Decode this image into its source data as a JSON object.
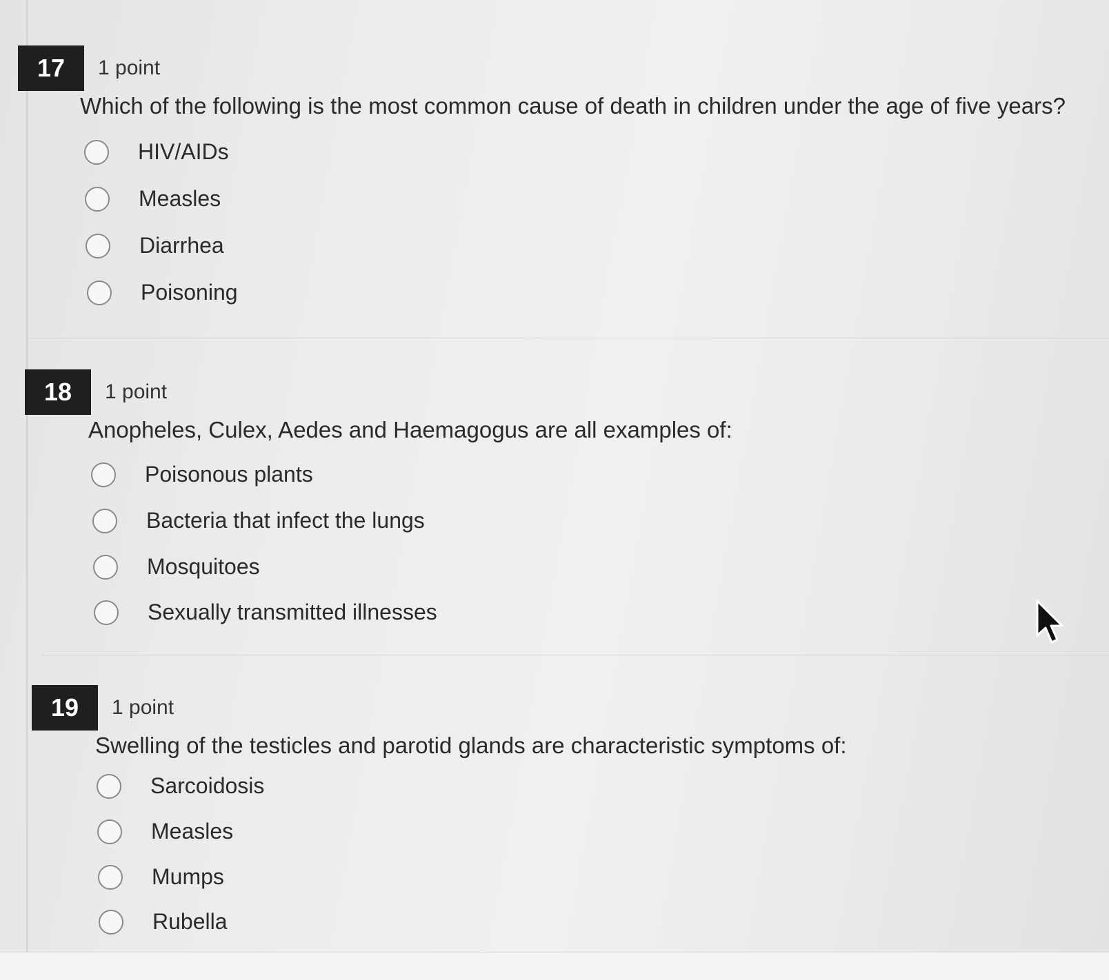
{
  "questions": [
    {
      "number": "17",
      "points": "1 point",
      "text": "Which of the following is the most common cause of death in children under the age of five years?",
      "options": [
        "HIV/AIDs",
        "Measles",
        "Diarrhea",
        "Poisoning"
      ]
    },
    {
      "number": "18",
      "points": "1 point",
      "text": "Anopheles, Culex, Aedes and Haemagogus are all examples of:",
      "options": [
        "Poisonous plants",
        "Bacteria that infect the lungs",
        "Mosquitoes",
        "Sexually transmitted illnesses"
      ]
    },
    {
      "number": "19",
      "points": "1 point",
      "text": "Swelling of the testicles and parotid glands are characteristic symptoms of:",
      "options": [
        "Sarcoidosis",
        "Measles",
        "Mumps",
        "Rubella"
      ]
    }
  ],
  "icons": {
    "radio": "radio-button-empty-icon",
    "pointer": "mouse-pointer-icon"
  },
  "colors": {
    "number_badge_bg": "#1f1f1f",
    "number_badge_text": "#ffffff",
    "radio_border": "#8a8a8a"
  }
}
